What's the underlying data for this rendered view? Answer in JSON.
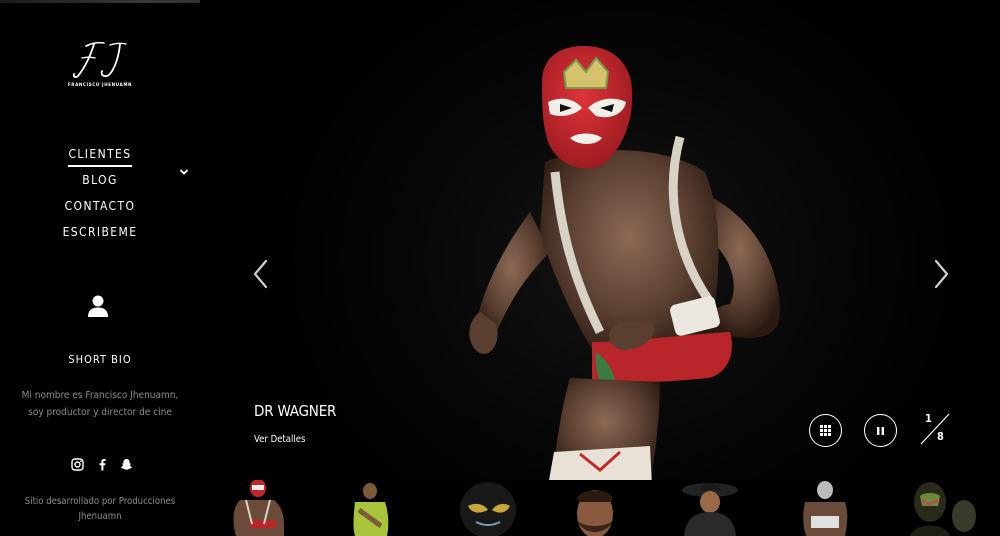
{
  "brand": {
    "monogram": "FJ",
    "name": "FRANCISCO JHENUAMN"
  },
  "nav": {
    "items": [
      {
        "label": "CLIENTES",
        "active": true
      },
      {
        "label": "BLOG",
        "active": false
      },
      {
        "label": "CONTACTO",
        "active": false
      },
      {
        "label": "ESCRIBEME",
        "active": false
      }
    ],
    "submenu_icon": "chevron-down-icon"
  },
  "bio": {
    "icon": "user-icon",
    "title": "SHORT BIO",
    "text": "Mi nombre es Francisco Jhenuamn, soy productor y director de cine"
  },
  "social": [
    {
      "icon": "instagram-icon"
    },
    {
      "icon": "facebook-icon"
    },
    {
      "icon": "snapchat-icon"
    }
  ],
  "credits": "Sitio desarrollado por Producciones Jhenuamn",
  "slider": {
    "title": "DR WAGNER",
    "link_label": "Ver Detalles",
    "current": "1",
    "total": "8",
    "prev_icon": "chevron-left-icon",
    "next_icon": "chevron-right-icon",
    "grid_icon": "grid-icon",
    "pause_icon": "pause-icon"
  },
  "thumbnails": [
    {
      "name": "masked wrestler red mask"
    },
    {
      "name": "wrestler green shirt"
    },
    {
      "name": "wrestler black gold mask"
    },
    {
      "name": "bearded man portrait"
    },
    {
      "name": "man with sombrero"
    },
    {
      "name": "wrestler silver mask"
    },
    {
      "name": "wrestler ornate mask"
    }
  ],
  "colors": {
    "background": "#000000",
    "text": "#ffffff",
    "muted_text": "#8c8c8c",
    "mask_red": "#c4262a"
  }
}
